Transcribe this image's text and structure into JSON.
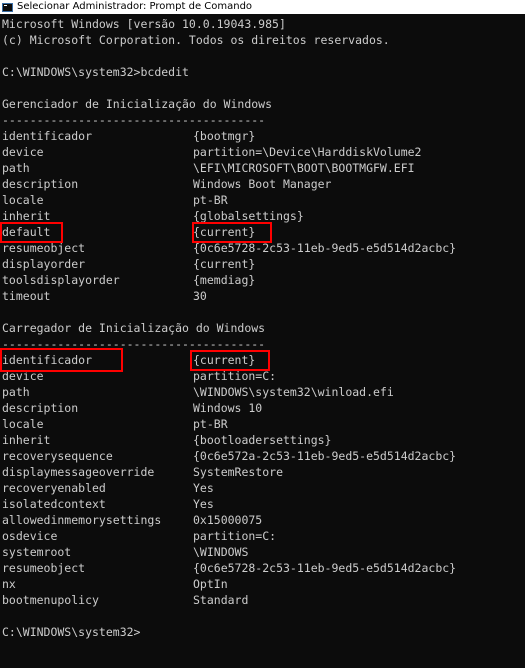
{
  "window": {
    "title": "Selecionar Administrador: Prompt de Comando"
  },
  "console": {
    "header1": "Microsoft Windows [versão 10.0.19043.985]",
    "header2": "(c) Microsoft Corporation. Todos os direitos reservados.",
    "prompt1": "C:\\WINDOWS\\system32>bcdedit",
    "section1_title": "Gerenciador de Inicialização do Windows",
    "section1_rule": "--------------------------------------",
    "section1": [
      {
        "key": "identificador",
        "value": "{bootmgr}"
      },
      {
        "key": "device",
        "value": "partition=\\Device\\HarddiskVolume2"
      },
      {
        "key": "path",
        "value": "\\EFI\\MICROSOFT\\BOOT\\BOOTMGFW.EFI"
      },
      {
        "key": "description",
        "value": "Windows Boot Manager"
      },
      {
        "key": "locale",
        "value": "pt-BR"
      },
      {
        "key": "inherit",
        "value": "{globalsettings}"
      },
      {
        "key": "default",
        "value": "{current}"
      },
      {
        "key": "resumeobject",
        "value": "{0c6e5728-2c53-11eb-9ed5-e5d514d2acbc}"
      },
      {
        "key": "displayorder",
        "value": "{current}"
      },
      {
        "key": "toolsdisplayorder",
        "value": "{memdiag}"
      },
      {
        "key": "timeout",
        "value": "30"
      }
    ],
    "section2_title": "Carregador de Inicialização do Windows",
    "section2_rule": "--------------------------------------",
    "section2": [
      {
        "key": "identificador",
        "value": "{current}"
      },
      {
        "key": "device",
        "value": "partition=C:"
      },
      {
        "key": "path",
        "value": "\\WINDOWS\\system32\\winload.efi"
      },
      {
        "key": "description",
        "value": "Windows 10"
      },
      {
        "key": "locale",
        "value": "pt-BR"
      },
      {
        "key": "inherit",
        "value": "{bootloadersettings}"
      },
      {
        "key": "recoverysequence",
        "value": "{0c6e572a-2c53-11eb-9ed5-e5d514d2acbc}"
      },
      {
        "key": "displaymessageoverride",
        "value": "SystemRestore"
      },
      {
        "key": "recoveryenabled",
        "value": "Yes"
      },
      {
        "key": "isolatedcontext",
        "value": "Yes"
      },
      {
        "key": "allowedinmemorysettings",
        "value": "0x15000075"
      },
      {
        "key": "osdevice",
        "value": "partition=C:"
      },
      {
        "key": "systemroot",
        "value": "\\WINDOWS"
      },
      {
        "key": "resumeobject",
        "value": "{0c6e5728-2c53-11eb-9ed5-e5d514d2acbc}"
      },
      {
        "key": "nx",
        "value": "OptIn"
      },
      {
        "key": "bootmenupolicy",
        "value": "Standard"
      }
    ],
    "prompt2": "C:\\WINDOWS\\system32>"
  },
  "highlight_color": "#ff0000"
}
